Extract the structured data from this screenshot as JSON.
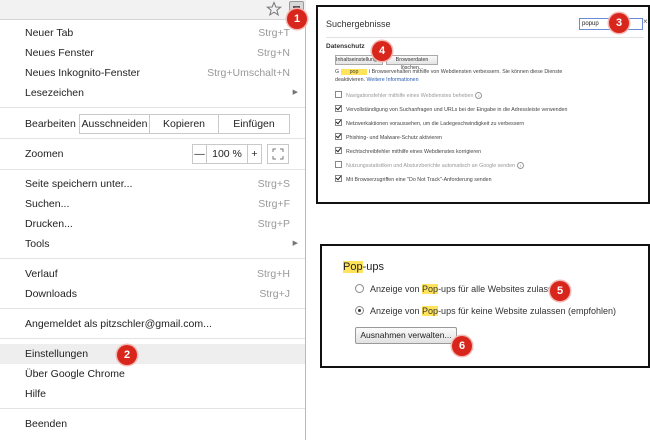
{
  "colors": {
    "callout": "#d9261c",
    "highlight": "#ffe35a",
    "link": "#2a5db0"
  },
  "menu": {
    "items": [
      {
        "label": "Neuer Tab",
        "shortcut": "Strg+T"
      },
      {
        "label": "Neues Fenster",
        "shortcut": "Strg+N"
      },
      {
        "label": "Neues Inkognito-Fenster",
        "shortcut": "Strg+Umschalt+N"
      },
      {
        "label": "Lesezeichen",
        "shortcut": ""
      },
      {
        "label": "Seite speichern unter...",
        "shortcut": "Strg+S"
      },
      {
        "label": "Suchen...",
        "shortcut": "Strg+F"
      },
      {
        "label": "Drucken...",
        "shortcut": "Strg+P"
      },
      {
        "label": "Tools",
        "shortcut": ""
      },
      {
        "label": "Verlauf",
        "shortcut": "Strg+H"
      },
      {
        "label": "Downloads",
        "shortcut": "Strg+J"
      },
      {
        "label": "Angemeldet als pitzschler@gmail.com...",
        "shortcut": ""
      },
      {
        "label": "Einstellungen",
        "shortcut": ""
      },
      {
        "label": "Über Google Chrome",
        "shortcut": ""
      },
      {
        "label": "Hilfe",
        "shortcut": ""
      },
      {
        "label": "Beenden",
        "shortcut": ""
      }
    ],
    "edit": {
      "label": "Bearbeiten",
      "cut": "Ausschneiden",
      "copy": "Kopieren",
      "paste": "Einfügen"
    },
    "zoom": {
      "label": "Zoomen",
      "minus": "—",
      "value": "100 %",
      "plus": "+"
    },
    "active_item": "Einstellungen"
  },
  "callouts": [
    "1",
    "2",
    "3",
    "4",
    "5",
    "6"
  ],
  "settings_panel": {
    "title": "Suchergebnisse",
    "search_value": "popup",
    "clear": "×",
    "section": "Datenschutz",
    "button_content_settings": "Inhaltseinstellungen...",
    "button_clear_data": "Browserdaten löschen...",
    "desc_line1_prefix": "G",
    "desc_line1_highlight": "pop",
    "desc_line1_suffix": "i Browservehalten mithilfe von Webdiensten verbessern. Sie können diese Dienste",
    "desc_line2_prefix": "deaktivieren.",
    "desc_line2_link": "Weitere Informationen",
    "options": [
      {
        "label": "Navigationsfehler mithilfe eines Webdienstes beheben",
        "checked": false
      },
      {
        "label": "Vervollständigung von Suchanfragen und URLs bei der Eingabe in die Adressleiste verwenden",
        "checked": true
      },
      {
        "label": "Netzwerkaktionen voraussehen, um die Ladegeschwindigkeit zu verbessern",
        "checked": true
      },
      {
        "label": "Phishing- und Malware-Schutz aktivieren",
        "checked": true
      },
      {
        "label": "Rechtschreibfehler mithilfe eines Webdienstes korrigieren",
        "checked": true
      },
      {
        "label": "Nutzungsstatistiken und Absturzberichte automatisch an Google senden",
        "checked": false
      },
      {
        "label": "Mit Browserzugriffen eine \"Do Not Track\"-Anforderung senden",
        "checked": true
      }
    ]
  },
  "popups_panel": {
    "title_highlight": "Pop",
    "title_rest": "-ups",
    "option_allow": {
      "prefix": "Anzeige von ",
      "highlight": "Pop",
      "suffix": "-ups für alle Websites zulassen",
      "selected": false
    },
    "option_block": {
      "prefix": "Anzeige von ",
      "highlight": "Pop",
      "suffix": "-ups für keine Website zulassen (empfohlen)",
      "selected": true
    },
    "manage_button": "Ausnahmen verwalten..."
  }
}
